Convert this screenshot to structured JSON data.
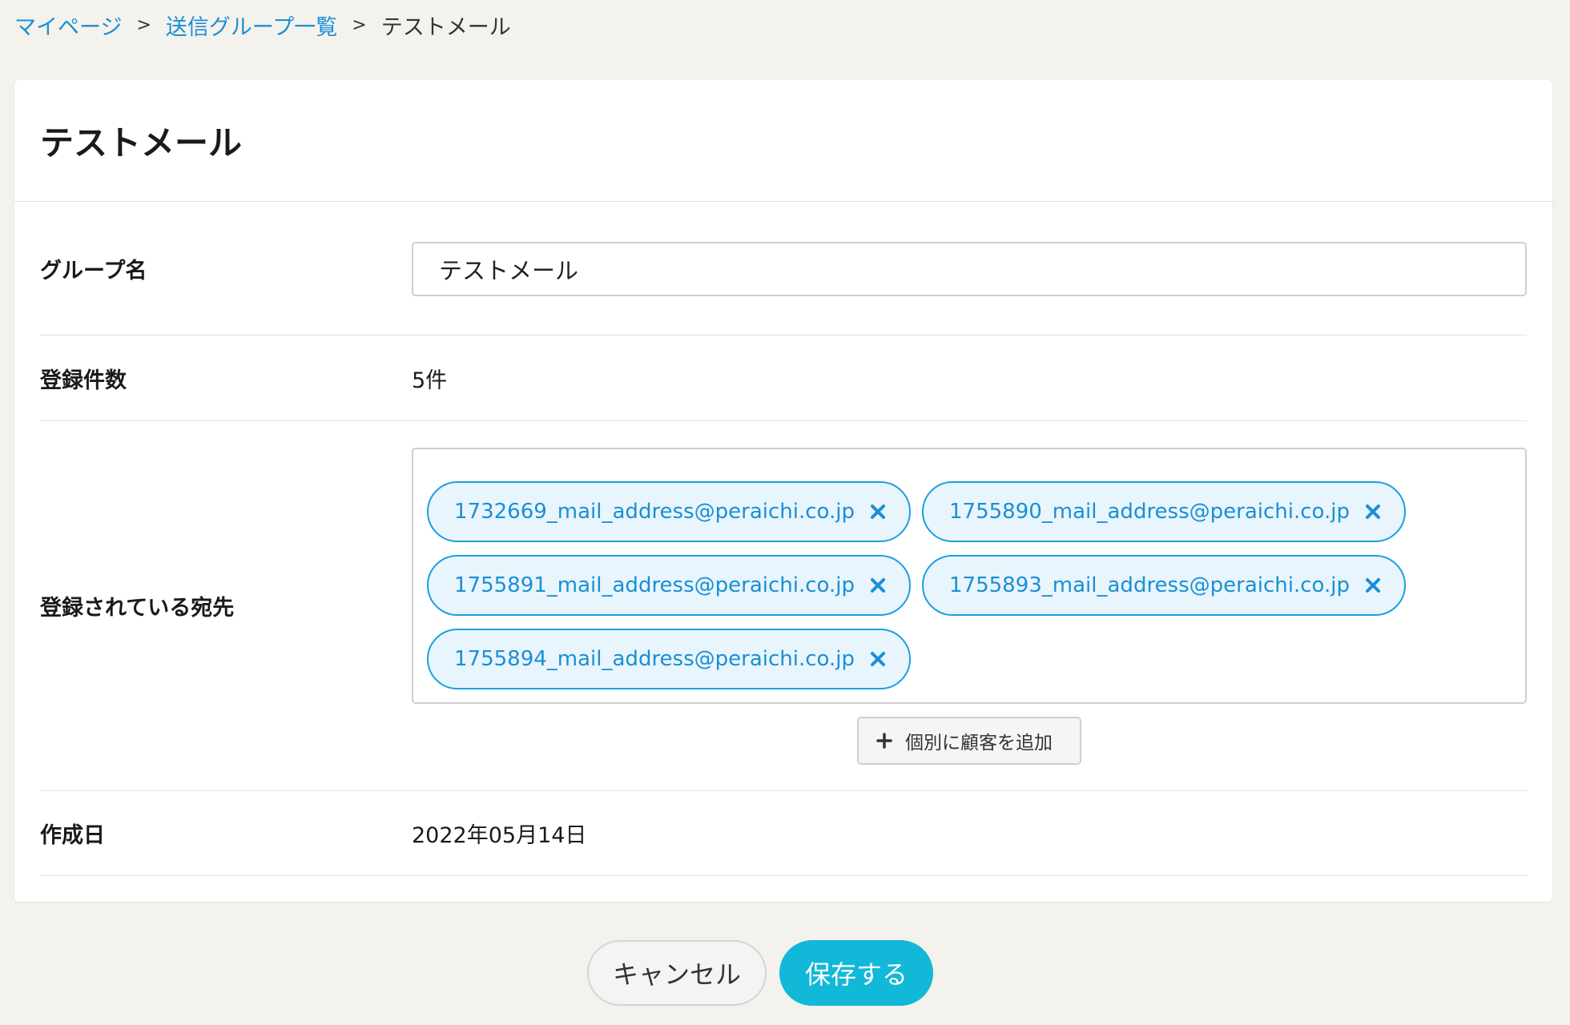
{
  "breadcrumb": {
    "items": [
      "マイページ",
      "送信グループ一覧"
    ],
    "separator": ">",
    "current": "テストメール"
  },
  "card": {
    "title": "テストメール"
  },
  "form": {
    "group_name_label": "グループ名",
    "group_name_value": "テストメール",
    "count_label": "登録件数",
    "count_value": "5件",
    "recipients_label": "登録されている宛先",
    "recipients": [
      "1732669_mail_address@peraichi.co.jp",
      "1755890_mail_address@peraichi.co.jp",
      "1755891_mail_address@peraichi.co.jp",
      "1755893_mail_address@peraichi.co.jp",
      "1755894_mail_address@peraichi.co.jp"
    ],
    "add_button_label": "個別に顧客を追加",
    "created_label": "作成日",
    "created_value": "2022年05月14日"
  },
  "actions": {
    "cancel_label": "キャンセル",
    "save_label": "保存する"
  },
  "colors": {
    "background": "#f4f2ec",
    "link": "#1a8fd6",
    "tag_border": "#1a9fe0",
    "tag_fill": "#e8f5fc",
    "primary": "#12b8d8"
  },
  "icons": {
    "tag_remove": "close-icon",
    "add": "plus-icon"
  }
}
